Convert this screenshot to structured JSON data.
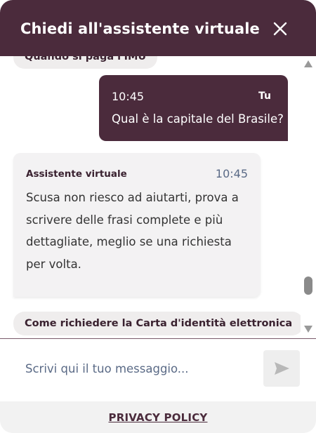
{
  "header": {
    "title": "Chiedi all'assistente virtuale",
    "close_icon": "close-icon"
  },
  "suggestions": {
    "top_partial": "Quando si paga l'IMU",
    "bottom": "Come richiedere la Carta d'identità elettronica"
  },
  "user_message": {
    "time": "10:45",
    "sender": "Tu",
    "text": "Qual è la capitale del Brasile?"
  },
  "bot_message": {
    "sender": "Assistente virtuale",
    "time": "10:45",
    "text": "Scusa non riesco ad aiutarti, prova a scrivere delle frasi complete e più dettagliate, meglio se una richiesta per volta."
  },
  "composer": {
    "placeholder": "Scrivi qui il tuo messaggio...",
    "value": "",
    "send_icon": "send-icon"
  },
  "footer": {
    "privacy_label": "PRIVACY POLICY"
  },
  "colors": {
    "brand": "#4b2b3c",
    "pill_bg": "#efeded",
    "bot_bubble_bg": "#f3f2f3",
    "footer_bg": "#f2f2f2",
    "time_text": "#5a6a86"
  }
}
